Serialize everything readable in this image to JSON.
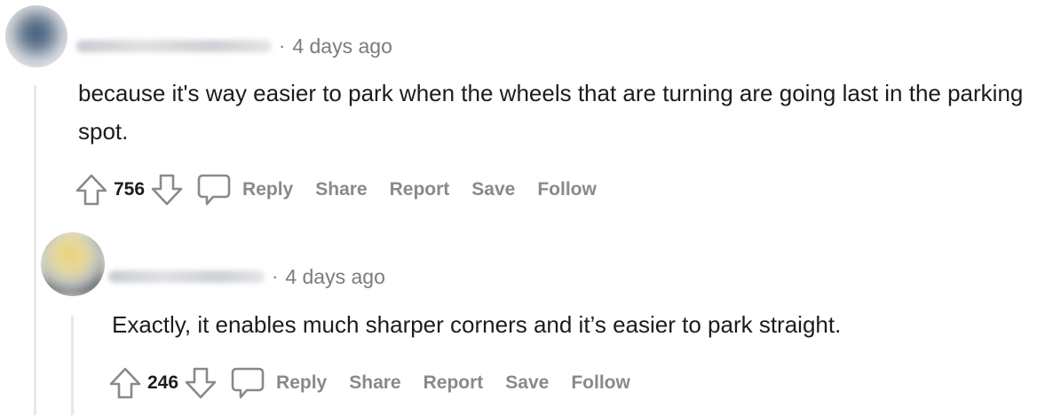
{
  "comments": [
    {
      "timestamp": "4 days ago",
      "separator": "·",
      "text": "because it's way easier to park when the wheels that are turning are going last in the parking spot.",
      "votes": "756",
      "actions": {
        "reply": "Reply",
        "share": "Share",
        "report": "Report",
        "save": "Save",
        "follow": "Follow"
      }
    },
    {
      "timestamp": "4 days ago",
      "separator": "·",
      "text": "Exactly, it enables much sharper corners and it’s easier to park straight.",
      "votes": "246",
      "actions": {
        "reply": "Reply",
        "share": "Share",
        "report": "Report",
        "save": "Save",
        "follow": "Follow"
      }
    }
  ],
  "icons": {
    "upvote": "upvote-arrow-icon",
    "downvote": "downvote-arrow-icon",
    "comment": "speech-bubble-icon"
  }
}
